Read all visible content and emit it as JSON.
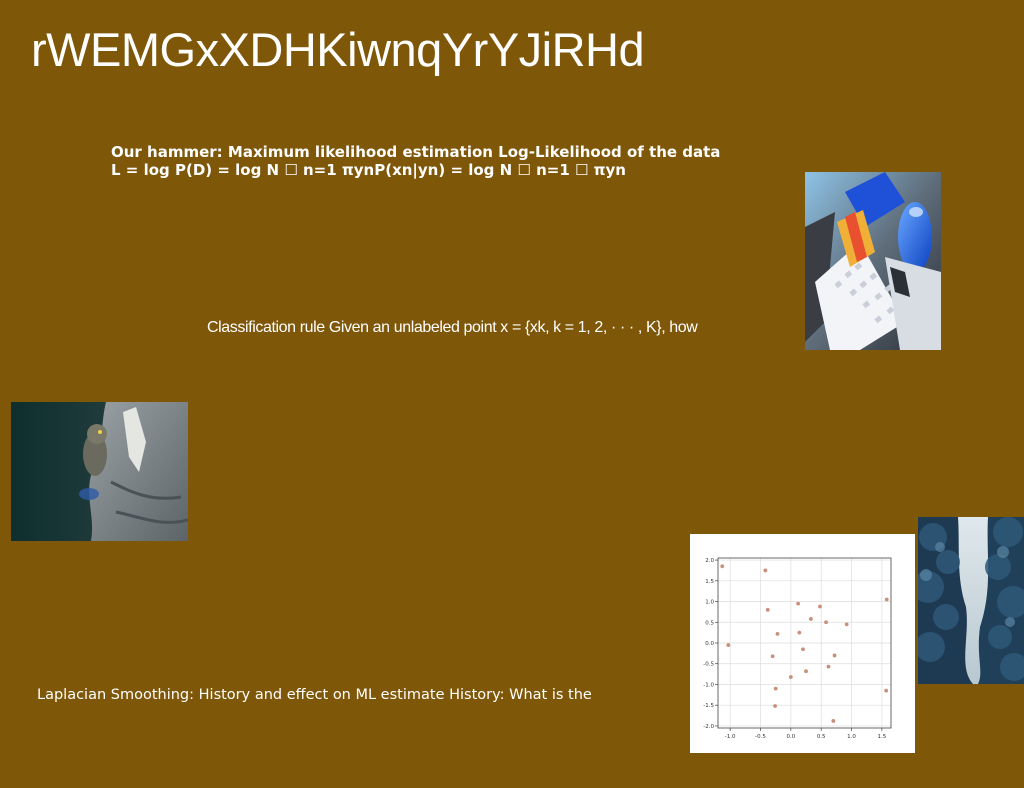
{
  "slide": {
    "title": "rWEMGxXDHKiwnqYrYJiRHd",
    "paragraph_1": "Our hammer: Maximum likelihood estimation Log-Likelihood of the data L = log P(D) = log N ☐ n=1 πynP(xn|yn) = log N ☐ n=1 ☐ πyn",
    "paragraph_2": "Classification rule Given an unlabeled point x = {xk, k = 1, 2, · · · , K}, how",
    "paragraph_3": "Laplacian Smoothing: History and effect on ML estimate History: What is the"
  },
  "colors": {
    "background": "#7f5708",
    "text": "#ffffff",
    "scatter_point": "#c8907a"
  },
  "chart_data": {
    "type": "scatter",
    "title": "",
    "xlabel": "",
    "ylabel": "",
    "xlim": [
      -1.2,
      1.65
    ],
    "ylim": [
      -2.05,
      2.05
    ],
    "x_ticks": [
      "-1.0",
      "-0.5",
      "0.0",
      "0.5",
      "1.0",
      "1.5"
    ],
    "x_tick_values": [
      -1.0,
      -0.5,
      0.0,
      0.5,
      1.0,
      1.5
    ],
    "y_ticks": [
      "2.0",
      "1.5",
      "1.0",
      "0.5",
      "0.0",
      "-0.5",
      "-1.0",
      "-1.5",
      "-2.0"
    ],
    "y_tick_values": [
      2.0,
      1.5,
      1.0,
      0.5,
      0.0,
      -0.5,
      -1.0,
      -1.5,
      -2.0
    ],
    "grid": true,
    "points": [
      {
        "x": -1.13,
        "y": 1.85
      },
      {
        "x": -1.03,
        "y": -0.05
      },
      {
        "x": -0.42,
        "y": 1.75
      },
      {
        "x": -0.38,
        "y": 0.8
      },
      {
        "x": -0.3,
        "y": -0.32
      },
      {
        "x": -0.22,
        "y": 0.22
      },
      {
        "x": -0.25,
        "y": -1.1
      },
      {
        "x": -0.26,
        "y": -1.52
      },
      {
        "x": 0.0,
        "y": -0.82
      },
      {
        "x": 0.12,
        "y": 0.95
      },
      {
        "x": 0.14,
        "y": 0.25
      },
      {
        "x": 0.2,
        "y": -0.15
      },
      {
        "x": 0.25,
        "y": -0.68
      },
      {
        "x": 0.33,
        "y": 0.58
      },
      {
        "x": 0.48,
        "y": 0.88
      },
      {
        "x": 0.58,
        "y": 0.5
      },
      {
        "x": 0.62,
        "y": -0.57
      },
      {
        "x": 0.72,
        "y": -0.3
      },
      {
        "x": 0.7,
        "y": -1.88
      },
      {
        "x": 0.92,
        "y": 0.45
      },
      {
        "x": 1.58,
        "y": 1.05
      },
      {
        "x": 1.57,
        "y": -1.15
      }
    ]
  }
}
